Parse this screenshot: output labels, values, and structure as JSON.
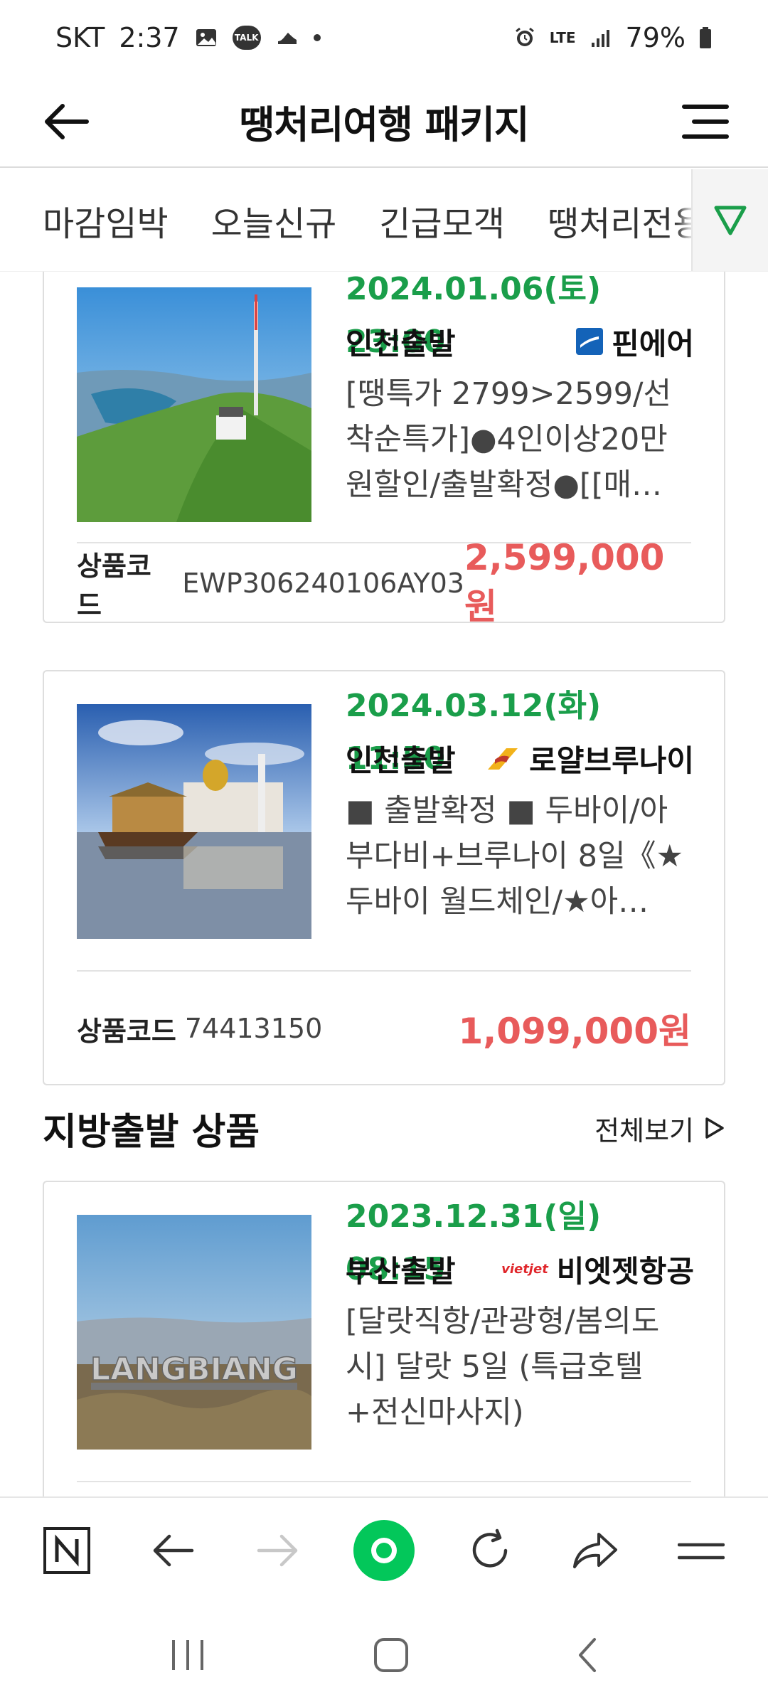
{
  "status": {
    "carrier": "SKT",
    "time": "2:37",
    "talk": "TALK",
    "network": "LTE",
    "battery": "79%"
  },
  "header": {
    "title": "땡처리여행 패키지"
  },
  "tabs": [
    "마감임박",
    "오늘신규",
    "긴급모객",
    "땡처리전용"
  ],
  "products": [
    {
      "date": "2024.01.06(토) 23:00",
      "departure": "인천출발",
      "airline": "핀에어",
      "description": "[땡특가 2799>2599/선착순특가]●4인이상20만원할인/출발확정●[[매…",
      "code_label": "상품코드",
      "code": "EWP306240106AY03",
      "price": "2,599,000원"
    },
    {
      "date": "2024.03.12(화) 11:50",
      "departure": "인천출발",
      "airline": "로얄브루나이",
      "description": "■ 출발확정 ■ 두바이/아부다비+브루나이 8일《★두바이 월드체인/★아…",
      "code_label": "상품코드",
      "code": "74413150",
      "price": "1,099,000원"
    }
  ],
  "regional_section": {
    "title": "지방출발 상품",
    "view_all": "전체보기"
  },
  "regional_products": [
    {
      "date": "2023.12.31(일) 08:15",
      "departure": "부산출발",
      "airline_logo": "vietjet",
      "airline": "비엣젯항공",
      "description": "[달랏직항/관광형/봄의도시] 달랏 5일 (특급호텔+전신마사지)",
      "image_text": "LANGBIANG"
    }
  ],
  "colors": {
    "date_green": "#1a9e4a",
    "price_red": "#e85b5b",
    "naver_green": "#03c75a"
  }
}
